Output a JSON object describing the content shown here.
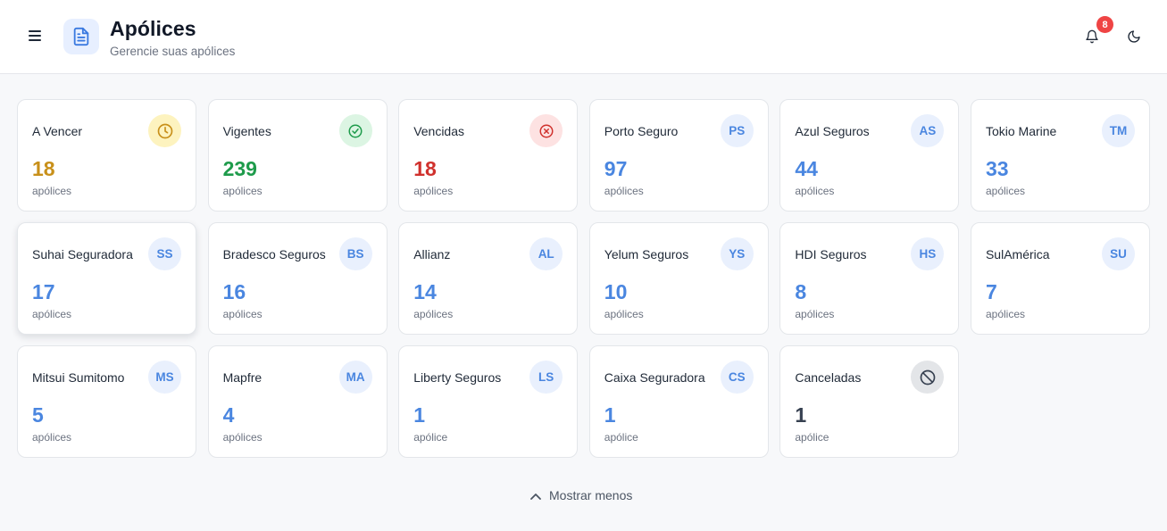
{
  "header": {
    "title": "Apólices",
    "subtitle": "Gerencie suas apólices",
    "notifications_count": "8",
    "menu_icon": "hamburger-icon",
    "title_icon": "document-icon",
    "bell_icon": "bell-icon",
    "theme_icon": "moon-icon"
  },
  "colors": {
    "accent": "#4a86e0",
    "warning": "#c8901a",
    "success": "#1e9b4b",
    "danger": "#d0312d",
    "neutral": "#374151",
    "badge": "#ef4444"
  },
  "cards": [
    {
      "label": "A Vencer",
      "value": "18",
      "unit": "apólices",
      "icon": "clock-icon"
    },
    {
      "label": "Vigentes",
      "value": "239",
      "unit": "apólices",
      "icon": "check-circle-icon"
    },
    {
      "label": "Vencidas",
      "value": "18",
      "unit": "apólices",
      "icon": "x-circle-icon"
    },
    {
      "label": "Porto Seguro",
      "value": "97",
      "unit": "apólices",
      "initials": "PS"
    },
    {
      "label": "Azul Seguros",
      "value": "44",
      "unit": "apólices",
      "initials": "AS"
    },
    {
      "label": "Tokio Marine",
      "value": "33",
      "unit": "apólices",
      "initials": "TM"
    },
    {
      "label": "Suhai Seguradora",
      "value": "17",
      "unit": "apólices",
      "initials": "SS"
    },
    {
      "label": "Bradesco Seguros",
      "value": "16",
      "unit": "apólices",
      "initials": "BS"
    },
    {
      "label": "Allianz",
      "value": "14",
      "unit": "apólices",
      "initials": "AL"
    },
    {
      "label": "Yelum Seguros",
      "value": "10",
      "unit": "apólices",
      "initials": "YS"
    },
    {
      "label": "HDI Seguros",
      "value": "8",
      "unit": "apólices",
      "initials": "HS"
    },
    {
      "label": "SulAmérica",
      "value": "7",
      "unit": "apólices",
      "initials": "SU"
    },
    {
      "label": "Mitsui Sumitomo",
      "value": "5",
      "unit": "apólices",
      "initials": "MS"
    },
    {
      "label": "Mapfre",
      "value": "4",
      "unit": "apólices",
      "initials": "MA"
    },
    {
      "label": "Liberty Seguros",
      "value": "1",
      "unit": "apólice",
      "initials": "LS"
    },
    {
      "label": "Caixa Seguradora",
      "value": "1",
      "unit": "apólice",
      "initials": "CS"
    },
    {
      "label": "Canceladas",
      "value": "1",
      "unit": "apólice",
      "icon": "ban-icon"
    }
  ],
  "footer": {
    "toggle_label": "Mostrar menos",
    "toggle_icon": "chevron-up-icon"
  }
}
